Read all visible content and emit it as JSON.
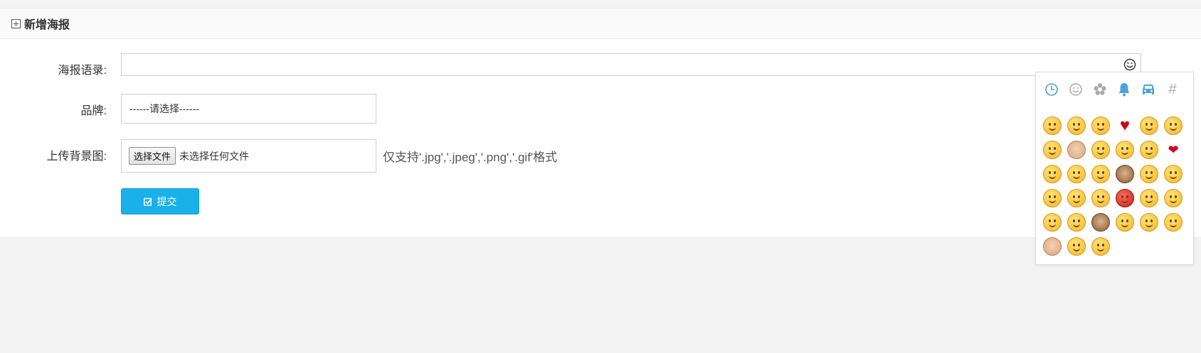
{
  "panel": {
    "title": "新增海报"
  },
  "form": {
    "slogan_label": "海报语录:",
    "slogan_value": "",
    "brand_label": "品牌:",
    "brand_selected": "------请选择------",
    "upload_label": "上传背景图:",
    "file_button": "选择文件",
    "file_status": "未选择任何文件",
    "file_hint": "仅支持'.jpg','.jpeg','.png','.gif'格式",
    "submit_label": "提交"
  },
  "emoji_picker": {
    "tabs": [
      "clock-icon",
      "smiley-tab-icon",
      "flower-icon",
      "bell-icon",
      "car-icon",
      "hash-icon"
    ],
    "hash_tab_label": "#",
    "active_tab": 0,
    "emojis": [
      "smile",
      "joy",
      "kissing-heart",
      "heart",
      "heart-eyes",
      "blush",
      "grin",
      "thumbsup",
      "relaxed",
      "relieved",
      "sob",
      "kiss",
      "unamused",
      "flushed",
      "stuck-out-tongue-winking-eye",
      "see-no-evil",
      "wink",
      "smiley",
      "cry",
      "stuck-out-tongue-closed-eyes",
      "scream",
      "rage",
      "smirk",
      "disappointed",
      "sweat-smile",
      "kissing-closed-eyes",
      "speak-no-evil",
      "relieved",
      "grinning",
      "yum",
      "ok-hand",
      "neutral-face",
      "confused"
    ]
  }
}
